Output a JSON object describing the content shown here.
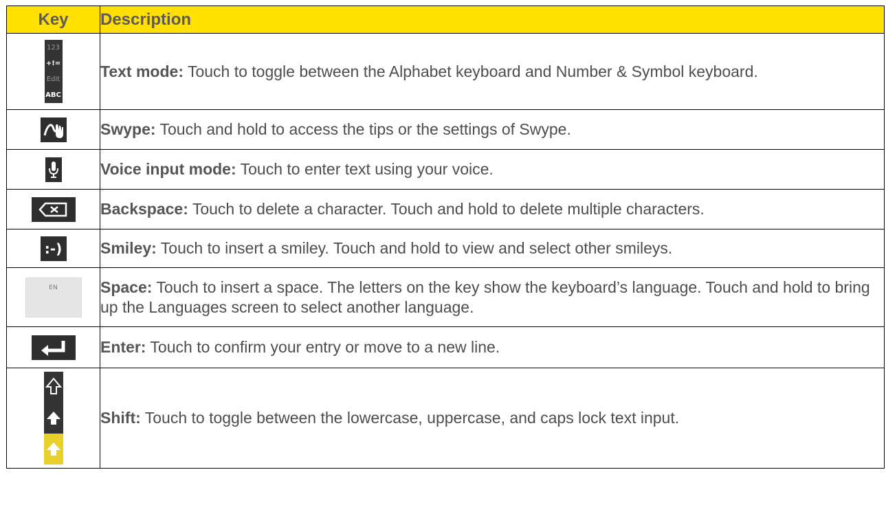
{
  "header": {
    "key": "Key",
    "description": "Description"
  },
  "rows": [
    {
      "icon": "text-mode-keys-icon",
      "key_labels": [
        "123",
        "+!=",
        "Edit",
        "ABC"
      ],
      "term": "Text mode:",
      "text": " Touch to toggle between the Alphabet keyboard and Number & Symbol keyboard."
    },
    {
      "icon": "swype-icon",
      "term": "Swype:",
      "text": " Touch and hold to access the tips or the settings of Swype."
    },
    {
      "icon": "microphone-icon",
      "term": "Voice input mode:",
      "text": " Touch to enter text using your voice."
    },
    {
      "icon": "backspace-icon",
      "term": "Backspace:",
      "text": " Touch to delete a character. Touch and hold to delete multiple characters."
    },
    {
      "icon": "smiley-key-icon",
      "key_label": ":-)",
      "term": "Smiley:",
      "text": " Touch to insert a smiley. Touch and hold to view and select other smileys."
    },
    {
      "icon": "space-key-icon",
      "key_label": "EN",
      "term": "Space:",
      "text": " Touch to insert a space. The letters on the key show the keyboard’s language. Touch and hold to bring up the Languages screen to select another language."
    },
    {
      "icon": "enter-icon",
      "term": "Enter:",
      "text": " Touch to confirm your entry or move to a new line."
    },
    {
      "icon": "shift-icons",
      "term": "Shift:",
      "text": " Touch to toggle between the lowercase, uppercase, and caps lock text input."
    }
  ],
  "colors": {
    "header_bg": "#ffe000",
    "key_bg": "#2e2e2e",
    "caps_bg": "#e8d12a"
  }
}
